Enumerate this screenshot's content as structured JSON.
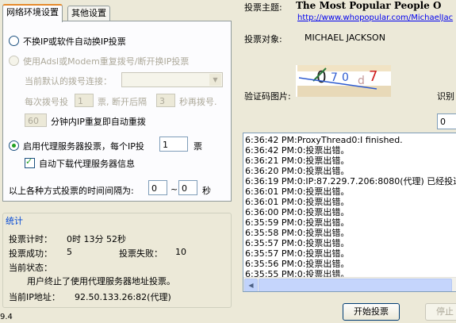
{
  "tabs": [
    "网络环境设置",
    "其他设置"
  ],
  "net": {
    "opt1": "不换IP或软件自动换IP投票",
    "opt2": "使用Adsl或Modem重复拨号/断开换IP投票",
    "current_dial_label": "当前默认的拨号连接：",
    "every_label_a": "每次拨号投",
    "every_val": "1",
    "every_label_b": "票, 断开后隔",
    "wait_val": "3",
    "every_label_c": "秒再拨号.",
    "redial_val": "60",
    "redial_label": "分钟内IP重复即自动重拨",
    "opt3": "启用代理服务器投票，每个IP投",
    "proxy_votes": "1",
    "proxy_unit": "票",
    "auto_download": "自动下载代理服务器信息",
    "interval_label": "以上各种方式投票的时间间隔为:",
    "interval_from": "0",
    "interval_sep": "~",
    "interval_to": "0",
    "interval_unit": "秒"
  },
  "stats": {
    "title": "统计",
    "timer_label": "投票计时：",
    "timer_value": "0时 13分 52秒",
    "success_label": "投票成功：",
    "success_value": "5",
    "fail_label": "投票失败：",
    "fail_value": "10",
    "status_label": "当前状态：",
    "status_value": "用户终止了使用代理服务器地址投票。",
    "ip_label": "当前IP地址：",
    "ip_value": "92.50.133.26:82(代理)"
  },
  "version_fragment": "9.4",
  "vote": {
    "subject_label": "投票主题:",
    "subject_title": "The Most Popular People O",
    "subject_url": "http://www.whopopular.com/MichaelJac",
    "target_label": "投票对象:",
    "target_value": "MICHAEL JACKSON",
    "captcha_label": "验证码图片:",
    "captcha_text": "0707",
    "recognize_label": "识别",
    "recognize_value": "0"
  },
  "log": [
    "6:36:42 PM:ProxyThread0:I finished.",
    "6:36:42 PM:0:投票出错。",
    "6:36:21 PM:0:投票出错。",
    "6:36:20 PM:0:投票出错。",
    "6:36:19 PM:0:IP:87.229.7.206:8080(代理) 已经投过票",
    "6:36:01 PM:0:投票出错。",
    "6:36:01 PM:0:投票出错。",
    "6:36:00 PM:0:投票出错。",
    "6:35:59 PM:0:投票出错。",
    "6:35:58 PM:0:投票出错。",
    "6:35:57 PM:0:投票出错。",
    "6:35:57 PM:0:投票出错。",
    "6:35:56 PM:0:投票出错。",
    "6:35:55 PM:0:投票出错。"
  ],
  "buttons": {
    "start": "开始投票",
    "stop": "停止"
  }
}
